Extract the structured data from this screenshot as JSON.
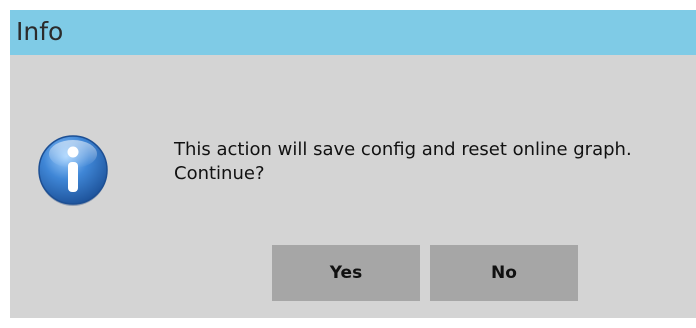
{
  "window": {
    "title": "Info"
  },
  "message": {
    "line1": "This action will save config and reset online graph.",
    "line2": "Continue?"
  },
  "buttons": {
    "yes_label": "Yes",
    "no_label": "No"
  },
  "icons": {
    "message_icon": "info-icon"
  },
  "colors": {
    "titlebar": "#7fcbe6",
    "dialog_background": "#d4d4d4",
    "button_background": "#a6a6a6",
    "icon_blue": "#2f6fc0"
  }
}
